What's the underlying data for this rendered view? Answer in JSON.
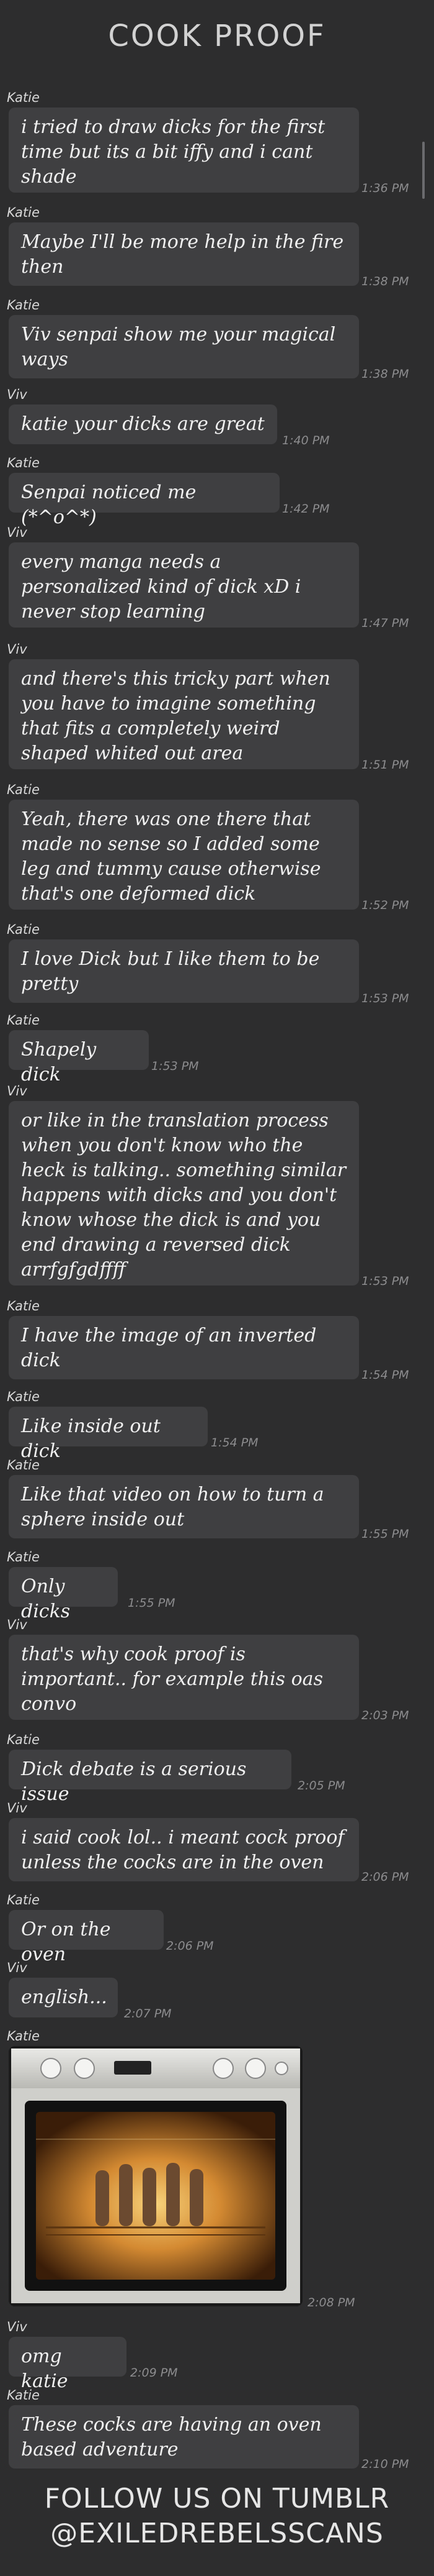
{
  "page": {
    "title": "COOK PROOF"
  },
  "messages": [
    {
      "sender": "Katie",
      "text": "i tried to draw dicks for the first time but its a bit iffy and i cant shade",
      "time": "1:36 PM"
    },
    {
      "sender": "Katie",
      "text": "Maybe I'll be more help in the fire then",
      "time": "1:38 PM"
    },
    {
      "sender": "Katie",
      "text": "Viv senpai show me your magical ways",
      "time": "1:38 PM"
    },
    {
      "sender": "Viv",
      "text": "katie your dicks are great",
      "time": "1:40 PM"
    },
    {
      "sender": "Katie",
      "text": "Senpai noticed me (*^o^*)",
      "time": "1:42 PM"
    },
    {
      "sender": "Viv",
      "text": "every manga needs a personalized kind of dick xD i never stop learning",
      "time": "1:47 PM"
    },
    {
      "sender": "Viv",
      "text": "and there's this tricky part when you have to imagine something that fits a completely weird shaped whited out area",
      "time": "1:51 PM"
    },
    {
      "sender": "Katie",
      "text": "Yeah, there was one there that made no sense so I added some leg and tummy cause otherwise that's one deformed dick",
      "time": "1:52 PM"
    },
    {
      "sender": "Katie",
      "text": "I love Dick but I like them to be pretty",
      "time": "1:53 PM"
    },
    {
      "sender": "Katie",
      "text": "Shapely dick",
      "time": "1:53 PM"
    },
    {
      "sender": "Viv",
      "text": "or like in the translation process when you don't know who the heck is talking.. something similar happens with dicks and you don't know whose the dick is and you end drawing a reversed dick arrfgfgdffff",
      "time": "1:53 PM"
    },
    {
      "sender": "Katie",
      "text": "I have the image of an inverted dick",
      "time": "1:54 PM"
    },
    {
      "sender": "Katie",
      "text": "Like inside out dick",
      "time": "1:54 PM"
    },
    {
      "sender": "Katie",
      "text": "Like that video on how to turn a sphere inside out",
      "time": "1:55 PM"
    },
    {
      "sender": "Katie",
      "text": "Only dicks",
      "time": "1:55 PM"
    },
    {
      "sender": "Viv",
      "text": "that's why cook proof is important.. for example this oas convo",
      "time": "2:03 PM"
    },
    {
      "sender": "Katie",
      "text": "Dick debate is a serious issue",
      "time": "2:05 PM"
    },
    {
      "sender": "Viv",
      "text": "i said cook lol.. i meant cock proof unless the cocks are in the oven",
      "time": "2:06 PM"
    },
    {
      "sender": "Katie",
      "text": "Or on the oven",
      "time": "2:06 PM"
    },
    {
      "sender": "Viv",
      "text": "english...",
      "time": "2:07 PM"
    },
    {
      "sender": "Katie",
      "text": "",
      "time": "2:08 PM",
      "image": "oven-photo"
    },
    {
      "sender": "Viv",
      "text": "omg katie",
      "time": "2:09 PM"
    },
    {
      "sender": "Katie",
      "text": "These cocks are having an oven based adventure",
      "time": "2:10 PM"
    }
  ],
  "footer": {
    "line1": "FOLLOW US ON TUMBLR",
    "line2": "@EXILEDREBELSSCANS"
  },
  "colors": {
    "background": "#2d2d2e",
    "bubble": "#3f3f41",
    "timestamp": "#8c8c8e"
  }
}
